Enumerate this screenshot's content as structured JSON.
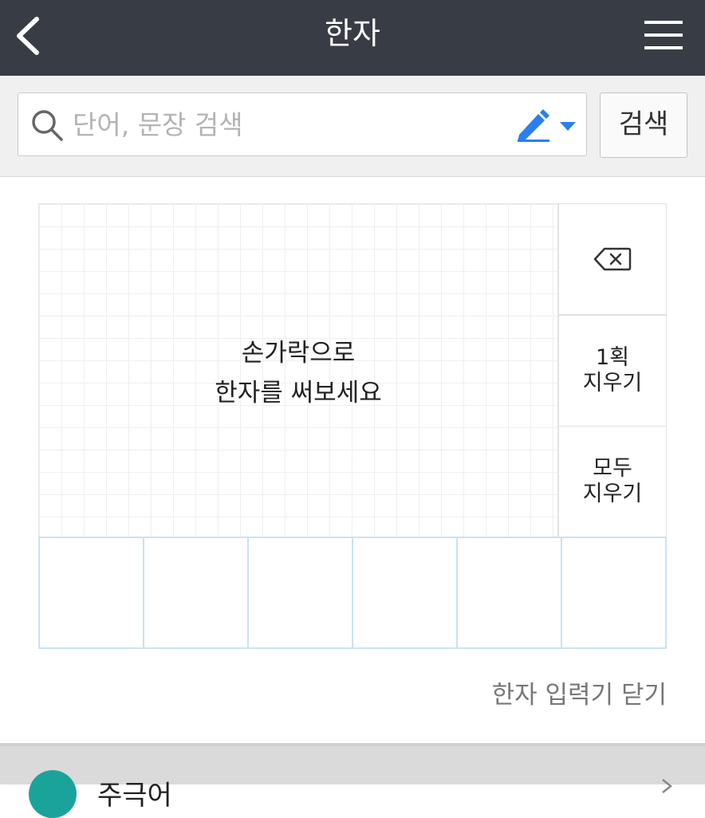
{
  "header": {
    "title": "한자"
  },
  "search": {
    "placeholder": "단어, 문장 검색",
    "button_label": "검색"
  },
  "pad": {
    "hint_line1": "손가락으로",
    "hint_line2": "한자를 써보세요"
  },
  "side_buttons": {
    "undo_stroke_line1": "1획",
    "undo_stroke_line2": "지우기",
    "clear_all_line1": "모두",
    "clear_all_line2": "지우기"
  },
  "candidates": [
    "",
    "",
    "",
    "",
    "",
    ""
  ],
  "close_label": "한자 입력기 닫기",
  "bottom": {
    "label": "주극어"
  },
  "icons": {
    "back": "back-arrow-icon",
    "menu": "hamburger-menu-icon",
    "search": "search-icon",
    "pen": "pen-icon",
    "backspace": "backspace-icon"
  },
  "colors": {
    "header_bg": "#383c44",
    "accent": "#2a7ef0",
    "candidate_border": "#c8e2f4",
    "avatar": "#1aa39a"
  }
}
